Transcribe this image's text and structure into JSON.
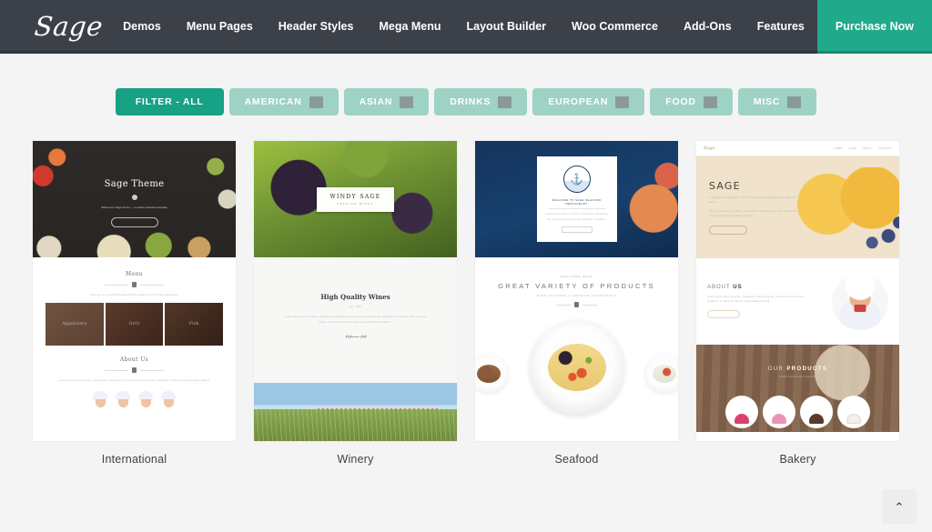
{
  "nav": {
    "logo": "Sage",
    "items": [
      {
        "label": "Demos"
      },
      {
        "label": "Menu Pages"
      },
      {
        "label": "Header Styles"
      },
      {
        "label": "Mega Menu"
      },
      {
        "label": "Layout Builder"
      },
      {
        "label": "Woo Commerce"
      },
      {
        "label": "Add-Ons"
      },
      {
        "label": "Features"
      }
    ],
    "cta": "Purchase Now",
    "bg_color": "#3b4049",
    "accent_color": "#20a98b"
  },
  "filters": {
    "active_index": 0,
    "items": [
      {
        "label": "FILTER - ALL",
        "active": true,
        "badge": false
      },
      {
        "label": "AMERICAN",
        "active": false,
        "badge": true
      },
      {
        "label": "ASIAN",
        "active": false,
        "badge": true
      },
      {
        "label": "DRINKS",
        "active": false,
        "badge": true
      },
      {
        "label": "EUROPEAN",
        "active": false,
        "badge": true
      },
      {
        "label": "FOOD",
        "active": false,
        "badge": true
      },
      {
        "label": "MISC",
        "active": false,
        "badge": true
      }
    ],
    "active_color": "#17a185",
    "inactive_color": "#9ed2c4"
  },
  "demos": [
    {
      "label": "International",
      "hero_title": "Sage Theme",
      "hero_sub": "Welcome to Sage Theme — a modern restaurant template",
      "section_title": "Menu",
      "section_sub": "Discover our carefully prepared dishes made from the finest ingredients",
      "tiles": [
        "Appetizers",
        "Grill",
        "Fish"
      ],
      "about_title": "About Us",
      "about_text": "Lorem ipsum dolor sit amet, consectetur adipiscing elit. Sed do eiusmod tempor incididunt ut labore et dolore magna aliqua."
    },
    {
      "label": "Winery",
      "plate_title": "WINDY SAGE",
      "plate_sub": "PREMIUM WINES",
      "section_title": "High Quality Wines",
      "section_sub": "Est. 1908",
      "body_text": "Lorem ipsum dolor sit amet, consectetur adipiscing elit, sed do eiusmod tempor incididunt ut labore et dolore magna aliqua. Ut enim ad minim veniam, quis nostrud exercitation.",
      "signature": "Signature"
    },
    {
      "label": "Seafood",
      "panel_title": "WELCOME TO SAGE SEAFOOD RESTAURANT",
      "panel_text": "Lorem ipsum dolor sit amet, consectetur adipiscing elit, sed do eiusmod tempor incididunt ut labore.",
      "panel_button": "READ MORE",
      "kicker": "EXPLORE OUR",
      "heading": "GREAT VARIETY OF PRODUCTS",
      "subheading": "MADE OF FRESH & PREMIUM INGREDIENTS"
    },
    {
      "label": "Bakery",
      "logo": "Sage",
      "nav": [
        "HOME",
        "SHOP",
        "ABOUT",
        "CONTACT"
      ],
      "hero_title": "SAGE",
      "hero_sub": "A DELIGHTFUL BAKERY FOR YOUR SWEET MOMENTS AND SPECIAL DAYS",
      "hero_text": "Lorem ipsum dolor sit amet, consectetur adipiscing elit, sed do eiusmod tempor incididunt ut labore et dolore.",
      "hero_button": "READ MORE",
      "about_pre": "ABOUT",
      "about_strong": "US",
      "about_text": "Lorem ipsum dolor sit amet, consectetur adipiscing elit, sed do eiusmod tempor incididunt ut labore et dolore magna aliqua nostrud.",
      "about_button": "READ MORE",
      "products_pre": "OUR",
      "products_strong": "PRODUCTS",
      "products_sub": "Freshly baked every single day"
    }
  ],
  "scroll_top": {
    "icon": "chevron-up-icon",
    "glyph": "⌃"
  }
}
